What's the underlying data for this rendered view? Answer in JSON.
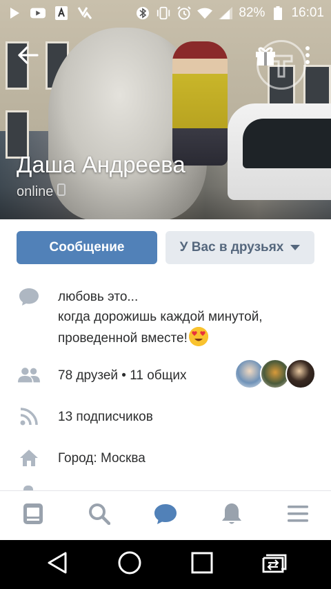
{
  "status_bar": {
    "left_icons": [
      "play-icon",
      "youtube-icon",
      "pdf-icon",
      "check-app-icon"
    ],
    "right_icons": [
      "bluetooth-icon",
      "vibrate-icon",
      "alarm-icon",
      "wifi-icon",
      "signal-icon"
    ],
    "battery": "82%",
    "time": "16:01"
  },
  "profile": {
    "name": "Даша Андреева",
    "online_status": "online"
  },
  "actions": {
    "message_label": "Сообщение",
    "friends_label": "У Вас в друзьях"
  },
  "info": {
    "status_line_1": "любовь это...",
    "status_line_2": "когда дорожишь каждой минутой,",
    "status_line_3": "проведенной вместе!",
    "friends": "78 друзей • 11 общих",
    "followers": "13 подписчиков",
    "city": "Город: Москва"
  },
  "colors": {
    "accent": "#5181b8",
    "secondary_button": "#e6eaef",
    "secondary_text": "#55677d",
    "icon_gray": "#aeb7c2",
    "tab_active": "#5181b8",
    "tab_inactive": "#99a2ad"
  },
  "tabbar": {
    "items": [
      "news-icon",
      "search-icon",
      "messages-icon",
      "notifications-icon",
      "menu-icon"
    ],
    "active": "messages-icon"
  },
  "navbar": {
    "items": [
      "back-triangle-icon",
      "home-circle-icon",
      "recents-square-icon",
      "screen-share-icon"
    ]
  }
}
